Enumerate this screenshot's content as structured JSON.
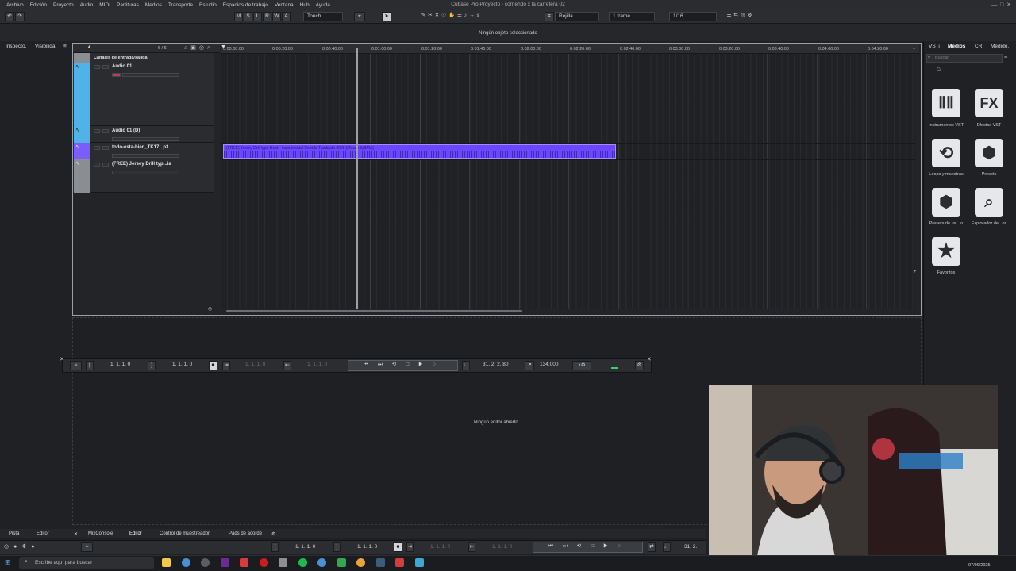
{
  "menu": [
    "Archivo",
    "Edición",
    "Proyecto",
    "Audio",
    "MIDI",
    "Partituras",
    "Medios",
    "Transporte",
    "Estudio",
    "Espacios de trabajo",
    "Ventana",
    "Hub",
    "Ayuda"
  ],
  "window_title": "Cubase Pro Proyecto - corriendo x la carretera 02",
  "toolbar": {
    "mode_buttons": [
      "M",
      "S",
      "L",
      "R",
      "W",
      "A"
    ],
    "automation_mode": "Touch",
    "grid_type": "Rejilla",
    "frame_mode": "1 frame",
    "quantize": "1/16"
  },
  "status": "Ningún objeto seleccionado",
  "inspector_tabs": [
    "Inspecto.",
    "Visibilida."
  ],
  "track_counter": "6 / 6",
  "folder_title": "Canales de entrada/salida",
  "tracks": [
    {
      "name": "Audio 01"
    },
    {
      "name": "Audio 01 (D)"
    },
    {
      "name": "todo-esta-bien_TK17...p3"
    },
    {
      "name": "(FREE) Jersey Drill typ...ia"
    }
  ],
  "ruler_ticks": [
    "0:00:00:00",
    "0:00:20:00",
    "0:00:40:00",
    "0:01:00:00",
    "0:01:20:00",
    "0:01:40:00",
    "0:02:00:00",
    "0:02:20:00",
    "0:02:40:00",
    "0:03:00:00",
    "0:03:20:00",
    "0:03:40:00",
    "0:04:00:00",
    "0:04:20:00"
  ],
  "clip": {
    "name": "(FREE) Jersey Drill type Beat - instrumental Corrido Tumbado 2025 [#MadeByBMA]"
  },
  "transport": {
    "left_locator": "1. 1. 1. 0",
    "right_locator": "1. 1. 1. 0",
    "punch_in": "1. 1. 1. 0",
    "punch_out": "1. 1. 1. 0",
    "position": "31. 2. 2. 80",
    "tempo": "134.000"
  },
  "lower_zone_empty": "Ningún editor abierto",
  "right_tabs": [
    "VSTi",
    "Medios",
    "CR",
    "Medido."
  ],
  "media_search_placeholder": "Buscar",
  "media_tiles": [
    {
      "label": "Instrumentos VST",
      "icon": "piano-keys-icon"
    },
    {
      "label": "Efectos VST",
      "icon": "fx-icon",
      "glyph": "FX"
    },
    {
      "label": "Loops y muestras",
      "icon": "loop-icon"
    },
    {
      "label": "Presets",
      "icon": "presets-icon"
    },
    {
      "label": "Presets de us...io",
      "icon": "user-presets-icon"
    },
    {
      "label": "Explorador de...os",
      "icon": "explorer-icon"
    },
    {
      "label": "Favoritos",
      "icon": "star-icon"
    }
  ],
  "bottom_tabs": [
    "Pista",
    "Editor",
    "MixConsole",
    "Editor",
    "Control de muestreador",
    "Pads de acorde"
  ],
  "bottom_transport": {
    "left_locator": "1. 1. 1. 0",
    "right_locator": "1. 1. 1. 0",
    "punch_in": "1. 1. 1. 0",
    "punch_out": "1. 1. 1. 0",
    "position": "31. 2."
  },
  "taskbar": {
    "search_placeholder": "Escribe aquí para buscar",
    "date": "07/09/2025"
  },
  "colors": {
    "clip": "#6b47ff",
    "track_blue": "#4fb3e8",
    "track_purple": "#7a5cff",
    "track_grey": "#8a8d92"
  }
}
